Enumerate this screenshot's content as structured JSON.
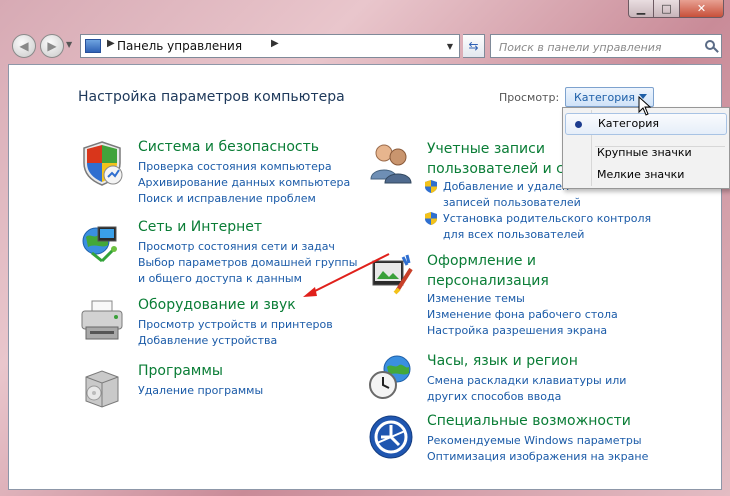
{
  "window": {
    "controls": {
      "minimize": "▁",
      "maximize": "□",
      "close": "✕"
    }
  },
  "navbar": {
    "back_icon": "back-arrow-icon",
    "forward_icon": "forward-arrow-icon",
    "breadcrumb": "Панель управления",
    "search_placeholder": "Поиск в панели управления"
  },
  "header": {
    "title": "Настройка параметров компьютера",
    "view_label": "Просмотр:",
    "view_value": "Категория"
  },
  "view_menu": {
    "items": [
      {
        "label": "Категория",
        "selected": true
      },
      {
        "label": "Крупные значки",
        "selected": false
      },
      {
        "label": "Мелкие значки",
        "selected": false
      }
    ]
  },
  "categories_left": [
    {
      "title": "Система и безопасность",
      "icon": "shield-system-icon",
      "links": [
        "Проверка состояния компьютера",
        "Архивирование данных компьютера",
        "Поиск и исправление проблем"
      ]
    },
    {
      "title": "Сеть и Интернет",
      "icon": "network-globe-icon",
      "links": [
        "Просмотр состояния сети и задач",
        "Выбор параметров домашней группы",
        "и общего доступа к данным"
      ]
    },
    {
      "title": "Оборудование и звук",
      "icon": "printer-hardware-icon",
      "links": [
        "Просмотр устройств и принтеров",
        "Добавление устройства"
      ]
    },
    {
      "title": "Программы",
      "icon": "programs-box-icon",
      "links": [
        "Удаление программы"
      ]
    }
  ],
  "categories_right": [
    {
      "title_lines": [
        "Учетные записи",
        "пользователей и се"
      ],
      "icon": "users-accounts-icon",
      "links": [
        "Добавление и удален",
        "записей пользователей",
        "Установка родительского контроля",
        "для всех пользователей"
      ]
    },
    {
      "title_lines": [
        "Оформление и",
        "персонализация"
      ],
      "icon": "personalization-paint-icon",
      "links": [
        "Изменение темы",
        "Изменение фона рабочего стола",
        "Настройка разрешения экрана"
      ]
    },
    {
      "title_lines": [
        "Часы, язык и регион"
      ],
      "icon": "clock-globe-icon",
      "links": [
        "Смена раскладки клавиатуры или",
        "других способов ввода"
      ]
    },
    {
      "title_lines": [
        "Специальные возможности"
      ],
      "icon": "accessibility-icon",
      "links": [
        "Рекомендуемые Windows параметры",
        "Оптимизация изображения на экране"
      ]
    }
  ],
  "colors": {
    "category_title": "#0a7d36",
    "link": "#1b5ba8",
    "annotation_arrow": "#e0201b"
  }
}
